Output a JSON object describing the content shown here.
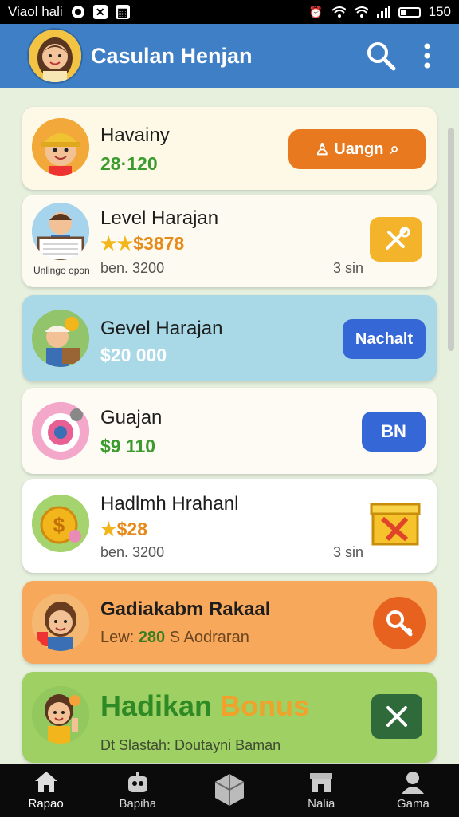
{
  "status_bar": {
    "carrier": "Viaol hali",
    "battery": "150"
  },
  "app_bar": {
    "title": "Casulan Henjan"
  },
  "cards": [
    {
      "name": "Havainy",
      "value": "28·120",
      "button": "Uangn",
      "color": "#fdf9e6"
    },
    {
      "name": "Level Harajan",
      "value": "$3878",
      "caption": "Unlingo opon",
      "sub": "ben. 3200",
      "time": "3 sin",
      "color": "#fdfbf1"
    },
    {
      "name": "Gevel Harajan",
      "value": "$20 000",
      "button": "Nachalt",
      "color": "#a9d9e6"
    },
    {
      "name": "Guajan",
      "value": "$9 110",
      "button": "BN",
      "color": "#fdfbf4"
    },
    {
      "name": "Hadlmh Hrahanl",
      "value": "$28",
      "sub": "ben. 3200",
      "time": "3 sin",
      "color": "#ffffff"
    },
    {
      "name": "Gadiakabm Rakaal",
      "value_label": "Lew:",
      "value": "280",
      "value_suffix": "S Aodraran",
      "color": "#f7a85a"
    },
    {
      "name_a": "Hadikan ",
      "name_b": "Bonus",
      "sub": "Dt Slastah: Doutayni Baman",
      "color": "#9ed063"
    }
  ],
  "nav": [
    {
      "label": "Rapao",
      "icon": "home-icon"
    },
    {
      "label": "Bapiha",
      "icon": "robot-icon"
    },
    {
      "label": "",
      "icon": "box-icon"
    },
    {
      "label": "Nalia",
      "icon": "shop-icon"
    },
    {
      "label": "Gama",
      "icon": "profile-icon"
    }
  ],
  "colors": {
    "app_bar": "#3f7fc6",
    "orange_btn": "#e8791f",
    "yellow_btn": "#f3b32a",
    "blue_btn": "#3567d6",
    "green_text": "#3c9b2e",
    "dark_green_btn": "#2f6a3a"
  }
}
